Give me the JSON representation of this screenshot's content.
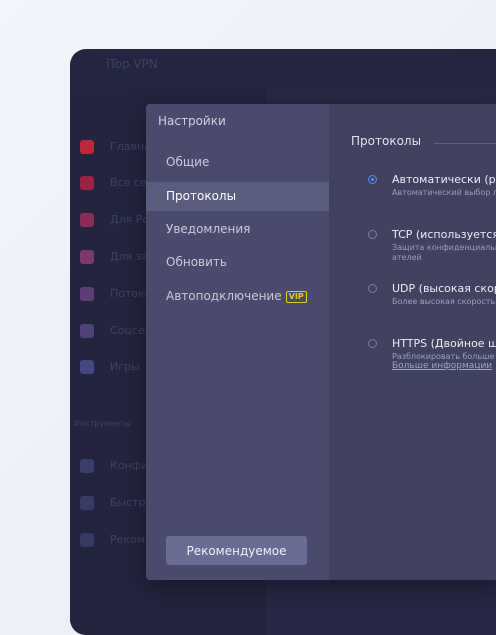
{
  "app": {
    "title": "iTop VPN",
    "nav": [
      {
        "label": "Главная",
        "icon": "home-icon",
        "color": "#b8293c"
      },
      {
        "label": "Все серверы",
        "icon": "grid-icon",
        "color": "#9c2241"
      },
      {
        "label": "Для России",
        "icon": "flag-icon",
        "color": "#8a2c56"
      },
      {
        "label": "Для загрузок",
        "icon": "download-icon",
        "color": "#7a3a6d"
      },
      {
        "label": "Потоковое видео",
        "icon": "video-icon",
        "color": "#5d3e74"
      },
      {
        "label": "Соцсети",
        "icon": "social-icon",
        "color": "#4e4277"
      },
      {
        "label": "Игры",
        "icon": "gamepad-icon",
        "color": "#454684"
      },
      {
        "label": "Конфиденциальность",
        "icon": "privacy-icon",
        "color": "#3a3e6b"
      },
      {
        "label": "Быстрый поиск",
        "icon": "link-icon",
        "color": "#363a64"
      },
      {
        "label": "Рекомендуемое",
        "icon": "apps-icon",
        "color": "#363a64"
      }
    ],
    "tools_section": "Инструменты"
  },
  "settings": {
    "title": "Настройки",
    "menu": [
      {
        "label": "Общие",
        "active": false
      },
      {
        "label": "Протоколы",
        "active": true
      },
      {
        "label": "Уведомления",
        "active": false
      },
      {
        "label": "Обновить",
        "active": false
      },
      {
        "label": "Автоподключение",
        "active": false,
        "badge": "VIP"
      }
    ],
    "recommended_button": "Рекомендуемое",
    "protocols": {
      "section_title": "Протоколы",
      "options": [
        {
          "name": "Автоматически (рекомендуется)",
          "desc": [
            "Автоматический выбор лучшего протокола"
          ],
          "checked": true
        },
        {
          "name": "TCP (используется по умолчанию)",
          "desc": [
            "Защита конфиденциальности для пользов",
            "ателей"
          ],
          "checked": false
        },
        {
          "name": "UDP (высокая скорость)",
          "desc": [
            "Более высокая скорость соединения"
          ],
          "checked": false
        },
        {
          "name": "HTTPS (Двойное шифрование)",
          "desc": [
            "Разблокировать больше сайтов"
          ],
          "checked": false
        }
      ],
      "more_info": "Больше информации"
    }
  },
  "colors": {
    "accent": "#4c8df6",
    "vip": "#f0c61d",
    "dialog_bg": "#4a4b6c",
    "active_menu": "#5b5d80"
  }
}
